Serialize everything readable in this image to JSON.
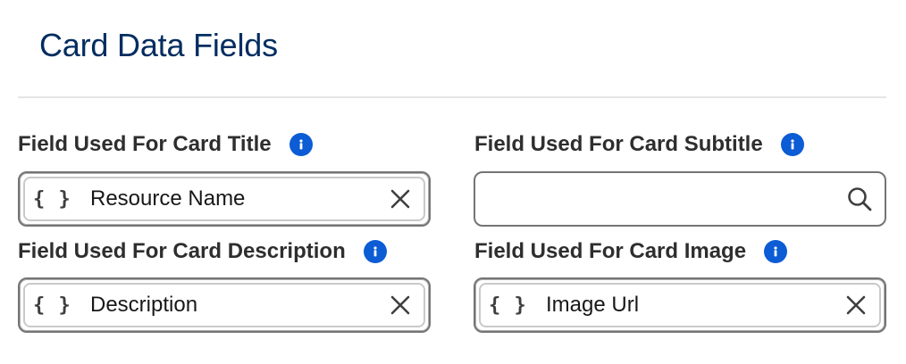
{
  "section": {
    "title": "Card Data Fields"
  },
  "fields": {
    "title": {
      "label": "Field Used For Card Title",
      "value": "Resource Name"
    },
    "subtitle": {
      "label": "Field Used For Card Subtitle",
      "value": "",
      "placeholder": ""
    },
    "description": {
      "label": "Field Used For Card Description",
      "value": "Description"
    },
    "image": {
      "label": "Field Used For Card Image",
      "value": "Image Url"
    }
  },
  "merge_token_symbol": "{ }",
  "icons": {
    "info": "info-icon",
    "clear": "close-icon",
    "search": "search-icon"
  },
  "colors": {
    "title": "#032d60",
    "info_badge": "#0b5cd5",
    "border": "#747474"
  }
}
